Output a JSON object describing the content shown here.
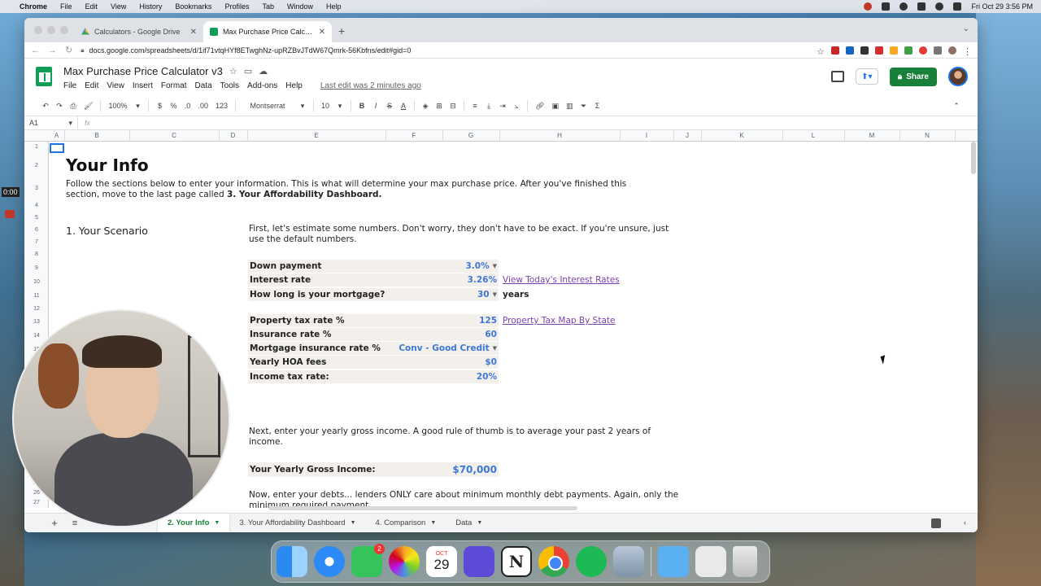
{
  "menubar": {
    "app": "Chrome",
    "items": [
      "File",
      "Edit",
      "View",
      "History",
      "Bookmarks",
      "Profiles",
      "Tab",
      "Window",
      "Help"
    ],
    "datetime": "Fri Oct 29  3:56 PM"
  },
  "recording": {
    "timer": "0:00"
  },
  "browser": {
    "tabs": [
      {
        "label": "Calculators - Google Drive",
        "active": false
      },
      {
        "label": "Max Purchase Price Calculator",
        "active": true
      }
    ],
    "url": "docs.google.com/spreadsheets/d/1if71vtqHYf8ETwghNz-upRZBvJTdW67Qmrk-56Kbfns/edit#gid=0"
  },
  "doc": {
    "title": "Max Purchase Price Calculator v3",
    "menus": [
      "File",
      "Edit",
      "View",
      "Insert",
      "Format",
      "Data",
      "Tools",
      "Add-ons",
      "Help"
    ],
    "last_edit": "Last edit was 2 minutes ago",
    "share_label": "Share"
  },
  "toolbar": {
    "zoom": "100%",
    "currency": "$",
    "percent": "%",
    "dec_less": ".0",
    "dec_more": ".00",
    "more_formats": "123",
    "font": "Montserrat",
    "font_size": "10",
    "bold": "B",
    "italic": "I",
    "strike": "S",
    "text_color": "A"
  },
  "formula_bar": {
    "cell_ref": "A1",
    "fx": "fx"
  },
  "columns": [
    "A",
    "B",
    "C",
    "D",
    "E",
    "F",
    "G",
    "H",
    "I",
    "J",
    "K",
    "L",
    "M",
    "N"
  ],
  "rows": [
    "1",
    "2",
    "3",
    "4",
    "5",
    "6",
    "7",
    "8",
    "9",
    "10",
    "11",
    "12",
    "13",
    "14",
    "15",
    "16",
    "17",
    "18",
    "19",
    "20",
    "21",
    "22",
    "23",
    "24",
    "25",
    "26",
    "27"
  ],
  "sheet": {
    "heading": "Your Info",
    "intro_text": "Follow the sections below to enter your information. This is what will determine your max purchase price. After you've finished this section, move to the last page called ",
    "intro_bold": "3. Your Affordability Dashboard.",
    "section_title": "1. Your Scenario",
    "para1": "First, let's estimate some numbers. Don't worry, they don't have to be exact. If you're unsure, just use the default numbers.",
    "fields": {
      "down_payment": {
        "label": "Down payment",
        "value": "3.0%"
      },
      "interest_rate": {
        "label": "Interest rate",
        "value": "3.26%"
      },
      "mortgage_length": {
        "label": "How long is your mortgage?",
        "value": "30",
        "unit": "years"
      },
      "property_tax": {
        "label": "Property tax rate %",
        "value": "125"
      },
      "insurance_rate": {
        "label": "Insurance rate %",
        "value": "60"
      },
      "mortgage_insurance": {
        "label": "Mortgage insurance rate %",
        "value": "Conv - Good Credit"
      },
      "hoa_fees": {
        "label": "Yearly HOA fees",
        "value": "$0"
      },
      "income_tax": {
        "label": "Income tax rate:",
        "value": "20%"
      }
    },
    "links": {
      "interest_rates": "View Today's Interest Rates",
      "property_tax_map": "Property Tax Map By State"
    },
    "para2": "Next, enter your yearly gross income. A good rule of thumb is to average your past 2 years of income.",
    "gross_income": {
      "label": "Your Yearly Gross Income:",
      "value": "$70,000"
    },
    "para3": "Now, enter your debts... lenders ONLY care about minimum monthly debt payments. Again, only the minimum required payment."
  },
  "sheet_tabs": [
    {
      "label": "2. Your Info",
      "active": true
    },
    {
      "label": "3. Your Affordability Dashboard",
      "active": false
    },
    {
      "label": "4. Comparison",
      "active": false
    },
    {
      "label": "Data",
      "active": false
    }
  ],
  "dock": {
    "messages_badge": "2",
    "calendar_month": "OCT",
    "calendar_day": "29",
    "notion_letter": "N"
  }
}
